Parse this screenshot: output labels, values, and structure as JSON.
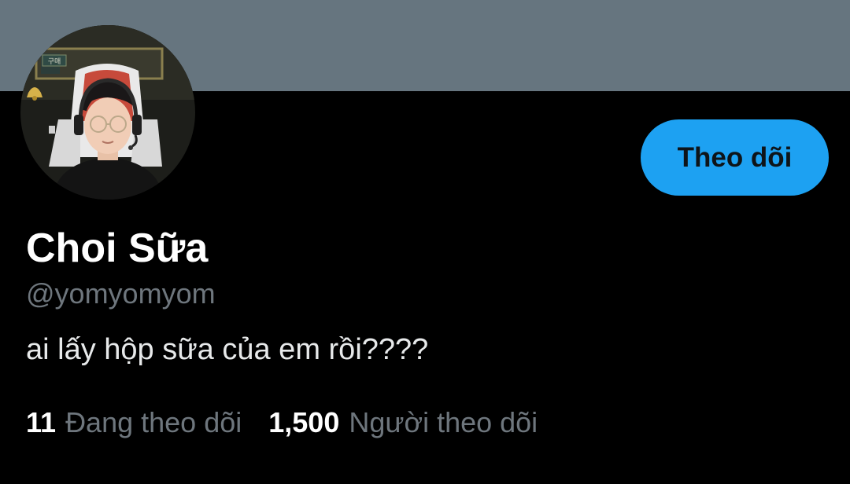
{
  "profile": {
    "display_name": "Choi Sữa",
    "handle": "@yomyomyom",
    "bio": "ai lấy hộp sữa của em rồi????"
  },
  "actions": {
    "follow_label": "Theo dõi"
  },
  "stats": {
    "following_count": "11",
    "following_label": "Đang theo dõi",
    "followers_count": "1,500",
    "followers_label": "Người theo dõi"
  },
  "avatar": {
    "sign_text": "구매"
  },
  "colors": {
    "banner": "#66757f",
    "background": "#000000",
    "accent": "#1da1f2",
    "muted_text": "#6e767d"
  }
}
